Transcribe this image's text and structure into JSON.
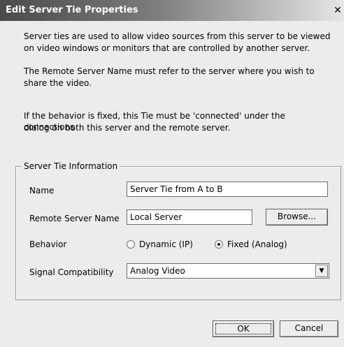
{
  "window": {
    "title": "Edit Server Tie Properties",
    "close_glyph": "✕"
  },
  "description": {
    "para1_line1": "Server ties are used to allow video sources from this server to be viewed",
    "para1_line2": "on video windows or monitors that are controlled by another server.",
    "para2_line1": "The Remote Server Name must refer to the server where you wish to",
    "para2_line2": "share the video.",
    "para3_line1": "If the behavior is fixed, this Tie must be 'connected' under the connections",
    "para3_line2": "dialog on both this server and the remote server."
  },
  "group": {
    "legend": "Server Tie Information",
    "name_label": "Name",
    "name_value": "Server Tie from A to B",
    "remote_label": "Remote Server Name",
    "remote_value": "Local Server",
    "browse_label": "Browse...",
    "behavior_label": "Behavior",
    "behavior_options": [
      "Dynamic (IP)",
      "Fixed (Analog)"
    ],
    "behavior_selected": "Fixed (Analog)",
    "signal_label": "Signal Compatibility",
    "signal_value": "Analog Video"
  },
  "buttons": {
    "ok": "OK",
    "cancel": "Cancel"
  },
  "icons": {
    "close": "close-icon",
    "dropdown": "chevron-down-icon"
  }
}
